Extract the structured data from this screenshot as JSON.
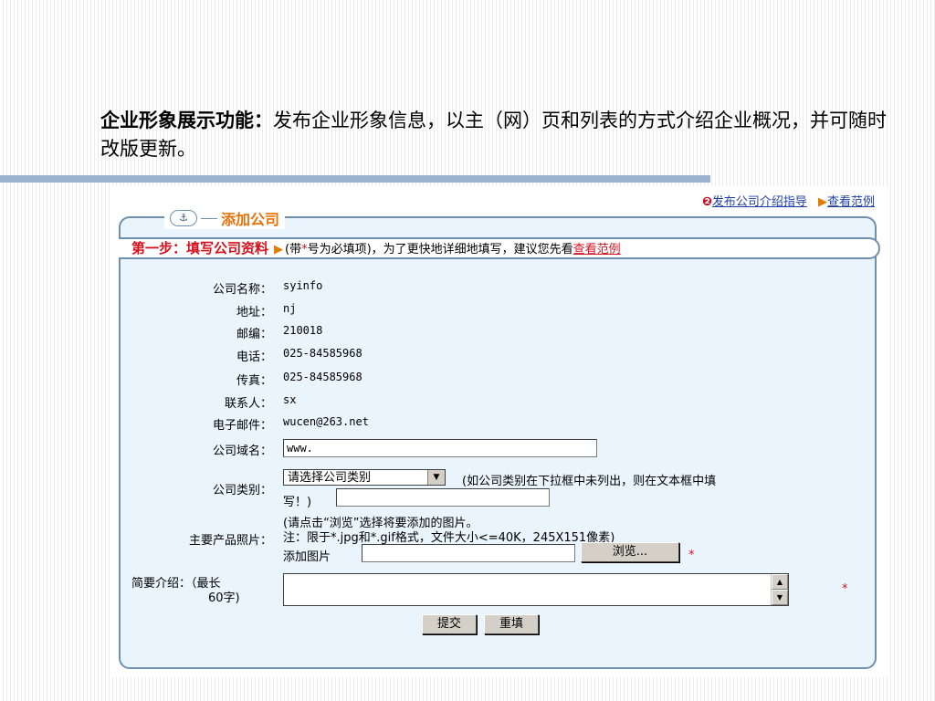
{
  "slide": {
    "heading_bold": "企业形象展示功能：",
    "heading_text": "发布企业形象信息，以主（网）页和列表的方式介绍企业概况，并可随时改版更新。"
  },
  "top_links": {
    "guide": "发布公司介绍指导",
    "example": "查看范例"
  },
  "panel": {
    "title": "添加公司",
    "step_label": "第一步：填写公司资料",
    "step_hint_pre": "(带",
    "step_hint_star": "*",
    "step_hint_mid": "号为必填项)，为了更快地详细地填写，建议您先看",
    "step_hint_link": "查看范例"
  },
  "fields": [
    {
      "label": "公司名称：",
      "value": "syinfo"
    },
    {
      "label": "地址：",
      "value": "nj"
    },
    {
      "label": "邮编：",
      "value": "210018"
    },
    {
      "label": "电话：",
      "value": "025-84585968"
    },
    {
      "label": "传真：",
      "value": "025-84585968"
    },
    {
      "label": "联系人：",
      "value": "sx"
    },
    {
      "label": "电子邮件：",
      "value": "wucen@263.net"
    }
  ],
  "domain": {
    "label": "公司域名：",
    "value": "www."
  },
  "category": {
    "label": "公司类别：",
    "selected": "请选择公司类别",
    "note_line1": "(如公司类别在下拉框中未列出，则在文本框中填",
    "note_line2": "写！)"
  },
  "photo": {
    "label": "主要产品照片：",
    "note_line1": "(请点击“浏览”选择将要添加的图片。",
    "note_line2": "注：限于*.jpg和*.gif格式，文件大小<=40K，245X151像素)",
    "add_label": "添加图片",
    "browse_label": "浏览...",
    "required_mark": "*"
  },
  "intro": {
    "label_line1": "简要介绍：（最长",
    "label_line2": "60字)",
    "required_mark": "*"
  },
  "buttons": {
    "submit": "提交",
    "reset": "重填"
  },
  "colors": {
    "accent_orange": "#e8720c",
    "required_red": "#d4121e",
    "panel_bg": "#e9f4fc",
    "border_blue": "#6f8fae"
  }
}
